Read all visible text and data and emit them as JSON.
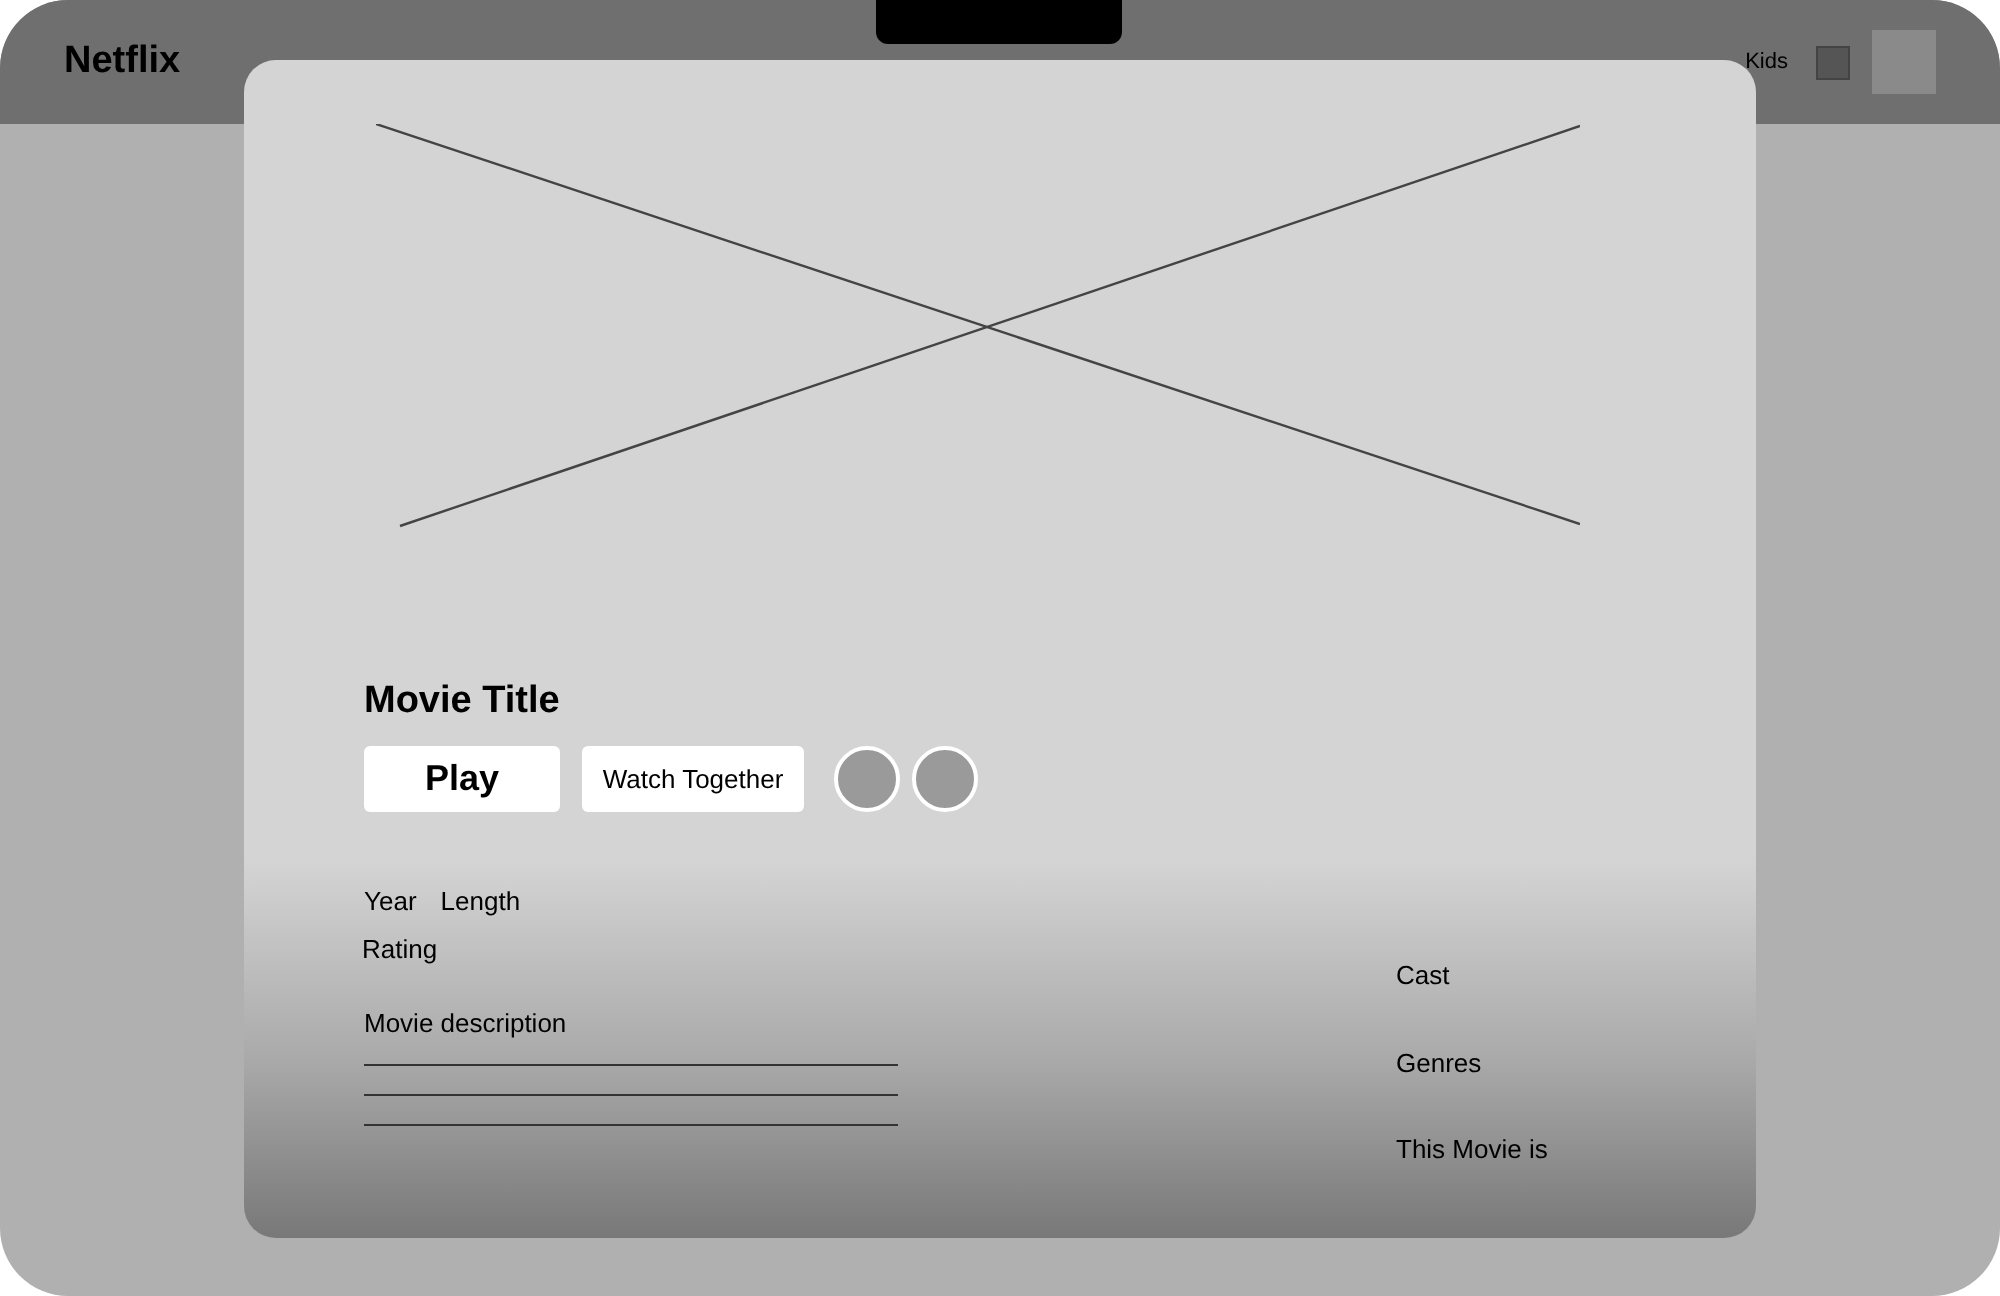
{
  "header": {
    "logo": "Netflix",
    "kids_label": "Kids"
  },
  "modal": {
    "title": "Movie Title",
    "buttons": [
      {
        "label": "Play",
        "kind": "primary"
      },
      {
        "label": "Watch Together",
        "kind": "secondary"
      }
    ],
    "round_buttons": [
      {
        "kind": "circle"
      },
      {
        "kind": "circle"
      }
    ],
    "meta": {
      "year": "Year",
      "length": "Length",
      "rating": "Rating"
    },
    "description_label": "Movie description",
    "description_lines": [
      {
        "kind": "rule"
      },
      {
        "kind": "rule"
      },
      {
        "kind": "rule"
      }
    ],
    "side": [
      "Cast",
      "Genres",
      "This Movie is"
    ]
  }
}
